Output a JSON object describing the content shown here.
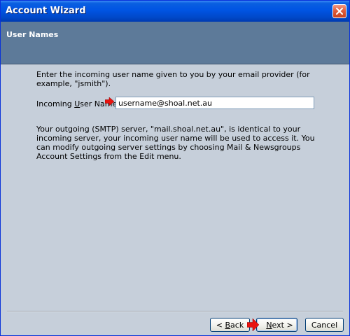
{
  "window": {
    "title": "Account Wizard"
  },
  "header": {
    "title": "User Names"
  },
  "main": {
    "description": "Enter the incoming user name given to you by your email provider (for example, \"jsmith\").",
    "incoming_label_prefix": "Incoming ",
    "incoming_label_accel": "U",
    "incoming_label_suffix": "ser Name:",
    "incoming_value": "username@shoal.net.au",
    "note": "Your outgoing (SMTP) server, \"mail.shoal.net.au\", is identical to your incoming server, your incoming user name will be used to access it. You can modify outgoing server settings by choosing Mail & Newsgroups Account Settings from the Edit menu."
  },
  "footer": {
    "back_prefix": "< ",
    "back_accel": "B",
    "back_suffix": "ack",
    "next_accel": "N",
    "next_suffix": "ext >",
    "cancel_label": "Cancel"
  },
  "colors": {
    "title_bar": "#0054e3",
    "header_band": "#5d7a99",
    "dialog_bg": "#c6cfda",
    "annotation_arrow": "#e8130f"
  },
  "icons": {
    "close": "close-icon",
    "annotation": "red-arrow-icon"
  }
}
